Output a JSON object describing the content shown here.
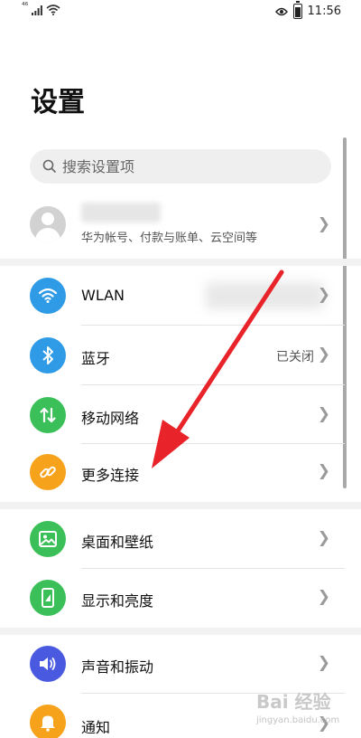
{
  "status_bar": {
    "signal_label": "⁴⁶",
    "signal_icon": "signal-icon",
    "wifi_icon": "wifi-icon",
    "eye_icon": "eye-icon",
    "battery_icon": "battery-icon",
    "time": "11:56"
  },
  "page_title": "设置",
  "search": {
    "placeholder": "搜索设置项",
    "icon": "search-icon"
  },
  "account": {
    "subtitle": "华为帐号、付款与账单、云空间等"
  },
  "sections": {
    "connectivity": {
      "wlan": {
        "label": "WLAN",
        "icon": "wifi-icon",
        "color": "#2f9ae6"
      },
      "bluetooth": {
        "label": "蓝牙",
        "value": "已关闭",
        "icon": "bluetooth-icon",
        "color": "#2f9ae6"
      },
      "mobile_network": {
        "label": "移动网络",
        "icon": "mobile-data-icon",
        "color": "#3bbf59"
      },
      "more_connections": {
        "label": "更多连接",
        "icon": "link-icon",
        "color": "#f6a21a"
      }
    },
    "display": {
      "wallpaper": {
        "label": "桌面和壁纸",
        "icon": "image-icon",
        "color": "#3bbf59"
      },
      "brightness": {
        "label": "显示和亮度",
        "icon": "phone-brightness-icon",
        "color": "#3bbf59"
      }
    },
    "sound": {
      "sound_vibration": {
        "label": "声音和振动",
        "icon": "speaker-icon",
        "color": "#4a5ae0"
      },
      "notifications": {
        "label": "通知",
        "icon": "bell-icon",
        "color": "#f6a21a"
      }
    }
  },
  "annotation": {
    "arrow_color": "#e8232a",
    "arrow_target": "更多连接"
  },
  "watermark": {
    "text": "Bai 经验",
    "sub": "jingyan.baidu.com"
  }
}
